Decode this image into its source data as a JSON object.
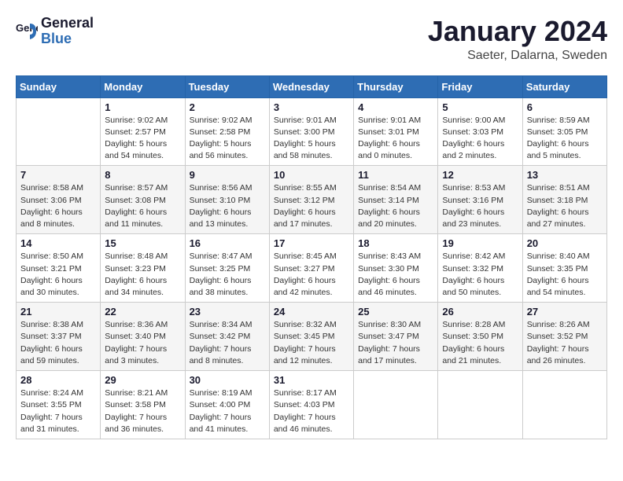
{
  "header": {
    "logo_line1": "General",
    "logo_line2": "Blue",
    "month_title": "January 2024",
    "location": "Saeter, Dalarna, Sweden"
  },
  "weekdays": [
    "Sunday",
    "Monday",
    "Tuesday",
    "Wednesday",
    "Thursday",
    "Friday",
    "Saturday"
  ],
  "weeks": [
    [
      {
        "day": "",
        "info": ""
      },
      {
        "day": "1",
        "info": "Sunrise: 9:02 AM\nSunset: 2:57 PM\nDaylight: 5 hours\nand 54 minutes."
      },
      {
        "day": "2",
        "info": "Sunrise: 9:02 AM\nSunset: 2:58 PM\nDaylight: 5 hours\nand 56 minutes."
      },
      {
        "day": "3",
        "info": "Sunrise: 9:01 AM\nSunset: 3:00 PM\nDaylight: 5 hours\nand 58 minutes."
      },
      {
        "day": "4",
        "info": "Sunrise: 9:01 AM\nSunset: 3:01 PM\nDaylight: 6 hours\nand 0 minutes."
      },
      {
        "day": "5",
        "info": "Sunrise: 9:00 AM\nSunset: 3:03 PM\nDaylight: 6 hours\nand 2 minutes."
      },
      {
        "day": "6",
        "info": "Sunrise: 8:59 AM\nSunset: 3:05 PM\nDaylight: 6 hours\nand 5 minutes."
      }
    ],
    [
      {
        "day": "7",
        "info": "Sunrise: 8:58 AM\nSunset: 3:06 PM\nDaylight: 6 hours\nand 8 minutes."
      },
      {
        "day": "8",
        "info": "Sunrise: 8:57 AM\nSunset: 3:08 PM\nDaylight: 6 hours\nand 11 minutes."
      },
      {
        "day": "9",
        "info": "Sunrise: 8:56 AM\nSunset: 3:10 PM\nDaylight: 6 hours\nand 13 minutes."
      },
      {
        "day": "10",
        "info": "Sunrise: 8:55 AM\nSunset: 3:12 PM\nDaylight: 6 hours\nand 17 minutes."
      },
      {
        "day": "11",
        "info": "Sunrise: 8:54 AM\nSunset: 3:14 PM\nDaylight: 6 hours\nand 20 minutes."
      },
      {
        "day": "12",
        "info": "Sunrise: 8:53 AM\nSunset: 3:16 PM\nDaylight: 6 hours\nand 23 minutes."
      },
      {
        "day": "13",
        "info": "Sunrise: 8:51 AM\nSunset: 3:18 PM\nDaylight: 6 hours\nand 27 minutes."
      }
    ],
    [
      {
        "day": "14",
        "info": "Sunrise: 8:50 AM\nSunset: 3:21 PM\nDaylight: 6 hours\nand 30 minutes."
      },
      {
        "day": "15",
        "info": "Sunrise: 8:48 AM\nSunset: 3:23 PM\nDaylight: 6 hours\nand 34 minutes."
      },
      {
        "day": "16",
        "info": "Sunrise: 8:47 AM\nSunset: 3:25 PM\nDaylight: 6 hours\nand 38 minutes."
      },
      {
        "day": "17",
        "info": "Sunrise: 8:45 AM\nSunset: 3:27 PM\nDaylight: 6 hours\nand 42 minutes."
      },
      {
        "day": "18",
        "info": "Sunrise: 8:43 AM\nSunset: 3:30 PM\nDaylight: 6 hours\nand 46 minutes."
      },
      {
        "day": "19",
        "info": "Sunrise: 8:42 AM\nSunset: 3:32 PM\nDaylight: 6 hours\nand 50 minutes."
      },
      {
        "day": "20",
        "info": "Sunrise: 8:40 AM\nSunset: 3:35 PM\nDaylight: 6 hours\nand 54 minutes."
      }
    ],
    [
      {
        "day": "21",
        "info": "Sunrise: 8:38 AM\nSunset: 3:37 PM\nDaylight: 6 hours\nand 59 minutes."
      },
      {
        "day": "22",
        "info": "Sunrise: 8:36 AM\nSunset: 3:40 PM\nDaylight: 7 hours\nand 3 minutes."
      },
      {
        "day": "23",
        "info": "Sunrise: 8:34 AM\nSunset: 3:42 PM\nDaylight: 7 hours\nand 8 minutes."
      },
      {
        "day": "24",
        "info": "Sunrise: 8:32 AM\nSunset: 3:45 PM\nDaylight: 7 hours\nand 12 minutes."
      },
      {
        "day": "25",
        "info": "Sunrise: 8:30 AM\nSunset: 3:47 PM\nDaylight: 7 hours\nand 17 minutes."
      },
      {
        "day": "26",
        "info": "Sunrise: 8:28 AM\nSunset: 3:50 PM\nDaylight: 6 hours\nand 21 minutes."
      },
      {
        "day": "27",
        "info": "Sunrise: 8:26 AM\nSunset: 3:52 PM\nDaylight: 7 hours\nand 26 minutes."
      }
    ],
    [
      {
        "day": "28",
        "info": "Sunrise: 8:24 AM\nSunset: 3:55 PM\nDaylight: 7 hours\nand 31 minutes."
      },
      {
        "day": "29",
        "info": "Sunrise: 8:21 AM\nSunset: 3:58 PM\nDaylight: 7 hours\nand 36 minutes."
      },
      {
        "day": "30",
        "info": "Sunrise: 8:19 AM\nSunset: 4:00 PM\nDaylight: 7 hours\nand 41 minutes."
      },
      {
        "day": "31",
        "info": "Sunrise: 8:17 AM\nSunset: 4:03 PM\nDaylight: 7 hours\nand 46 minutes."
      },
      {
        "day": "",
        "info": ""
      },
      {
        "day": "",
        "info": ""
      },
      {
        "day": "",
        "info": ""
      }
    ]
  ]
}
